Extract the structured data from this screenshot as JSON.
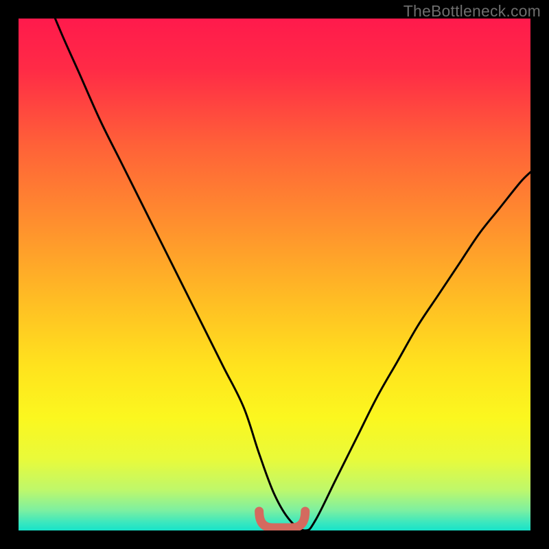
{
  "watermark": "TheBottleneck.com",
  "chart_data": {
    "type": "line",
    "title": "",
    "xlabel": "",
    "ylabel": "",
    "xlim": [
      0,
      100
    ],
    "ylim": [
      0,
      100
    ],
    "grid": false,
    "series": [
      {
        "name": "bottleneck-curve",
        "x": [
          0,
          4,
          8,
          12,
          16,
          20,
          24,
          28,
          32,
          36,
          40,
          44,
          47,
          50,
          53,
          56,
          58,
          62,
          66,
          70,
          74,
          78,
          82,
          86,
          90,
          94,
          98,
          100
        ],
        "y": [
          120,
          108,
          98,
          89,
          80,
          72,
          64,
          56,
          48,
          40,
          32,
          24,
          15,
          7,
          2,
          0,
          2,
          10,
          18,
          26,
          33,
          40,
          46,
          52,
          58,
          63,
          68,
          70
        ]
      }
    ],
    "annotations": [
      {
        "name": "optimal-flat-region",
        "x_range": [
          47,
          56
        ],
        "y": 0
      }
    ],
    "gradient_stops": [
      {
        "offset": 0.0,
        "color": "#ff1a4c"
      },
      {
        "offset": 0.1,
        "color": "#ff2b46"
      },
      {
        "offset": 0.25,
        "color": "#ff6238"
      },
      {
        "offset": 0.4,
        "color": "#ff8f2e"
      },
      {
        "offset": 0.55,
        "color": "#ffbd24"
      },
      {
        "offset": 0.68,
        "color": "#ffe31e"
      },
      {
        "offset": 0.78,
        "color": "#fbf71f"
      },
      {
        "offset": 0.86,
        "color": "#e9fa3a"
      },
      {
        "offset": 0.92,
        "color": "#bff86a"
      },
      {
        "offset": 0.96,
        "color": "#7ef0a0"
      },
      {
        "offset": 0.985,
        "color": "#39e7bf"
      },
      {
        "offset": 1.0,
        "color": "#17e3c9"
      }
    ],
    "accent_marker_color": "#d46a5f"
  }
}
